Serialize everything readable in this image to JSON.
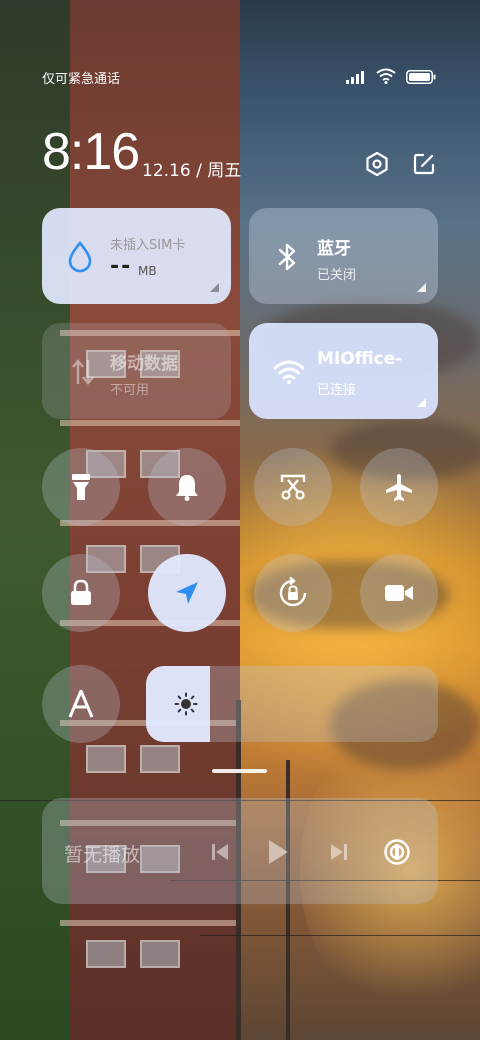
{
  "status": {
    "carrier_text": "仅可紧急通话"
  },
  "header": {
    "time": "8:16",
    "date": "12.16 / 周五"
  },
  "tiles": {
    "data_usage": {
      "title": "未插入SIM卡",
      "value": "--",
      "unit": "MB"
    },
    "bluetooth": {
      "name": "蓝牙",
      "status": "已关闭"
    },
    "mobile_data": {
      "name": "移动数据",
      "status": "不可用"
    },
    "wifi": {
      "name": "MIOffice-",
      "status": "已连接"
    }
  },
  "toggles": [
    {
      "name": "flashlight-icon",
      "active": false
    },
    {
      "name": "bell-icon",
      "active": false
    },
    {
      "name": "screenshot-icon",
      "active": false
    },
    {
      "name": "airplane-icon",
      "active": false
    },
    {
      "name": "lock-icon",
      "active": false
    },
    {
      "name": "location-icon",
      "active": true
    },
    {
      "name": "rotation-lock-icon",
      "active": false
    },
    {
      "name": "video-camera-icon",
      "active": false
    },
    {
      "name": "font-size-icon",
      "active": false
    }
  ],
  "brightness": {
    "level": 0.22
  },
  "media": {
    "now_playing": "暂无播放"
  },
  "colors": {
    "accent_blue": "#2f8ff0",
    "tile_light": "#e1e9ff"
  }
}
